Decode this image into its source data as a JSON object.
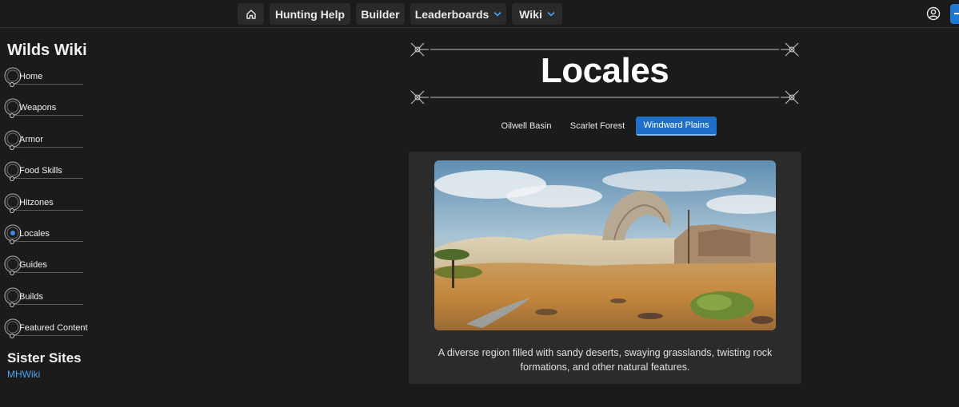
{
  "nav": {
    "home_icon": "home-icon",
    "items": [
      {
        "label": "Hunting Help"
      },
      {
        "label": "Builder"
      },
      {
        "label": "Leaderboards",
        "has_dropdown": true
      },
      {
        "label": "Wiki",
        "has_dropdown": true
      }
    ],
    "account_icon": "user-circle-icon",
    "accent_color": "#1e78d2"
  },
  "sidebar": {
    "title": "Wilds Wiki",
    "items": [
      {
        "label": "Home"
      },
      {
        "label": "Weapons"
      },
      {
        "label": "Armor"
      },
      {
        "label": "Food Skills"
      },
      {
        "label": "Hitzones"
      },
      {
        "label": "Locales",
        "active": true
      },
      {
        "label": "Guides"
      },
      {
        "label": "Builds"
      },
      {
        "label": "Featured Content"
      }
    ],
    "sister_title": "Sister Sites",
    "sister_links": [
      {
        "label": "MHWiki"
      }
    ]
  },
  "main": {
    "title": "Locales",
    "tabs": [
      {
        "label": "Oilwell Basin",
        "selected": false
      },
      {
        "label": "Scarlet Forest",
        "selected": false
      },
      {
        "label": "Windward Plains",
        "selected": true
      }
    ],
    "locale": {
      "image_alt": "Windward Plains landscape",
      "description": "A diverse region filled with sandy deserts, swaying grasslands, twisting rock formations, and other natural features."
    }
  }
}
